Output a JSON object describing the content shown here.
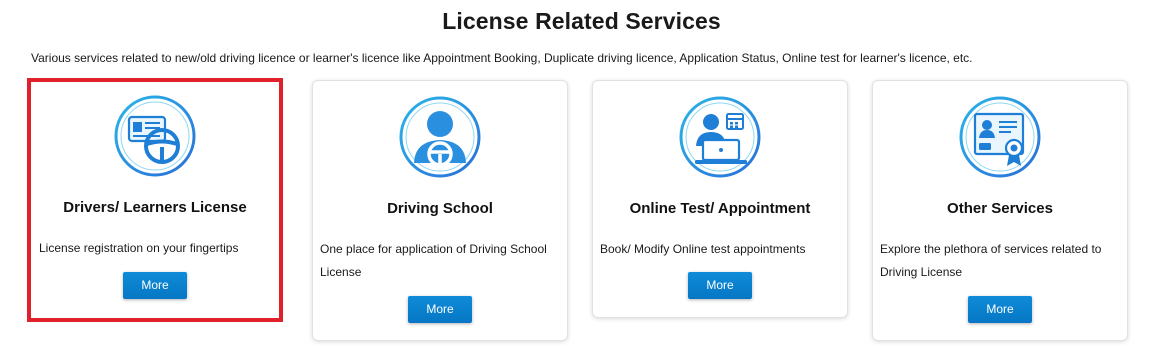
{
  "page": {
    "title": "License Related Services",
    "subtitle": "Various services related to new/old driving licence or learner's licence like Appointment Booking, Duplicate driving licence, Application Status, Online test for learner's licence, etc."
  },
  "cards": [
    {
      "title": "Drivers/ Learners License",
      "description": "License registration on your fingertips",
      "button": "More",
      "icon": "license-steering-icon",
      "selected": true
    },
    {
      "title": "Driving School",
      "description": "One place for application of Driving School License",
      "button": "More",
      "icon": "driver-icon"
    },
    {
      "title": "Online Test/ Appointment",
      "description": "Book/ Modify Online test appointments",
      "button": "More",
      "icon": "online-test-icon"
    },
    {
      "title": "Other Services",
      "description": "Explore the plethora of services related to Driving License",
      "button": "More",
      "icon": "certificate-icon"
    }
  ],
  "colors": {
    "accent": "#0a7fcf",
    "icon_gradient_start": "#2ab6e8",
    "icon_gradient_end": "#2a6fd8",
    "highlight_border": "#e0202a"
  }
}
